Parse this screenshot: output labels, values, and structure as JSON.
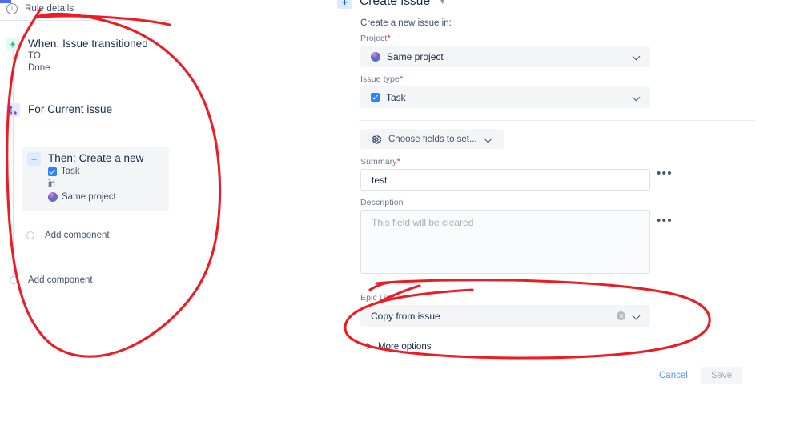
{
  "left_panel": {
    "rule_details": {
      "label": "Rule details",
      "icon": "info-icon"
    },
    "nodes": [
      {
        "type": "trigger",
        "icon": "lightning-bolt-icon",
        "title": "When: Issue transitioned",
        "sub_lines": [
          "TO",
          "Done"
        ]
      },
      {
        "type": "branch",
        "icon": "branch-icon",
        "title": "For Current issue",
        "sub_lines": []
      },
      {
        "type": "action",
        "icon": "plus-icon",
        "title": "Then: Create a new",
        "item_label": "Task",
        "connector": "in",
        "target_label": "Same project"
      }
    ],
    "add_component_inner": "Add component",
    "add_component_outer": "Add component"
  },
  "right_panel": {
    "title": "Create issue",
    "title_icon": "plus-icon",
    "subtitle": "Create a new issue in:",
    "fields": {
      "project": {
        "label": "Project",
        "required": true,
        "value": "Same project",
        "icon": "project-avatar-icon"
      },
      "issue_type": {
        "label": "Issue type",
        "required": true,
        "value": "Task",
        "icon": "task-icon"
      },
      "summary": {
        "label": "Summary",
        "required": true,
        "value": "test"
      },
      "description": {
        "label": "Description",
        "required": false,
        "placeholder": "This field will be cleared"
      },
      "epic_link": {
        "label": "Epic Link",
        "required": false,
        "value": "Copy from issue"
      }
    },
    "choose_fields_button": {
      "label": "Choose fields to set...",
      "icon": "gear-icon"
    },
    "more_options": "More options",
    "actions": {
      "cancel_label": "Cancel",
      "save_label": "Save",
      "save_disabled": true
    },
    "dots_menu_label": "•••"
  },
  "annotations": {
    "color": "#ed1c24",
    "shapes": [
      {
        "name": "left-rule-tree-circle",
        "type": "freehand-ellipse"
      },
      {
        "name": "epic-link-circle",
        "type": "freehand-ellipse"
      }
    ]
  },
  "colors": {
    "accent_blue": "#0052cc",
    "link_blue": "#4c9aff",
    "required_red": "#de350b",
    "annotation_red": "#ed1c24",
    "field_bg": "#f4f5f7",
    "text_primary": "#172b4d",
    "text_secondary": "#42526e",
    "text_muted": "#6b778c"
  }
}
